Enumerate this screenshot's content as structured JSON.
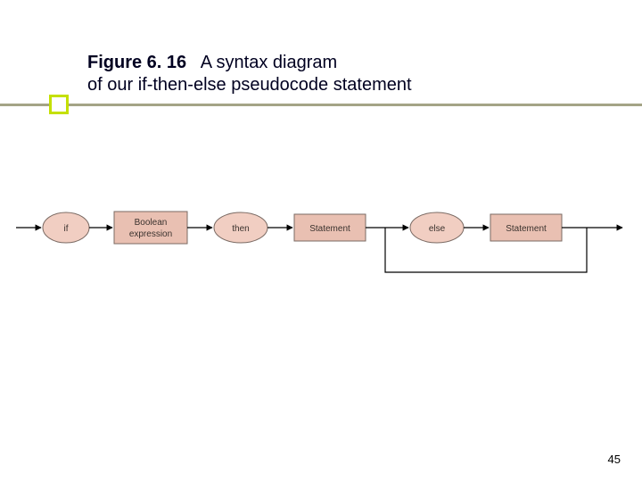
{
  "figure": {
    "label": "Figure 6. 16",
    "description_line1": "A syntax diagram",
    "description_line2": "of our if-then-else pseudocode statement"
  },
  "diagram": {
    "type": "syntax-diagram",
    "nodes": {
      "if": {
        "kind": "terminal",
        "text": "if"
      },
      "boolexpr_l1": {
        "kind": "nonterminal",
        "text": "Boolean"
      },
      "boolexpr_l2": {
        "kind": "nonterminal",
        "text": "expression"
      },
      "then": {
        "kind": "terminal",
        "text": "then"
      },
      "stmt1": {
        "kind": "nonterminal",
        "text": "Statement"
      },
      "else": {
        "kind": "terminal",
        "text": "else"
      },
      "stmt2": {
        "kind": "nonterminal",
        "text": "Statement"
      }
    },
    "bypass_sequence": [
      "else",
      "stmt2"
    ]
  },
  "page_number": "45"
}
